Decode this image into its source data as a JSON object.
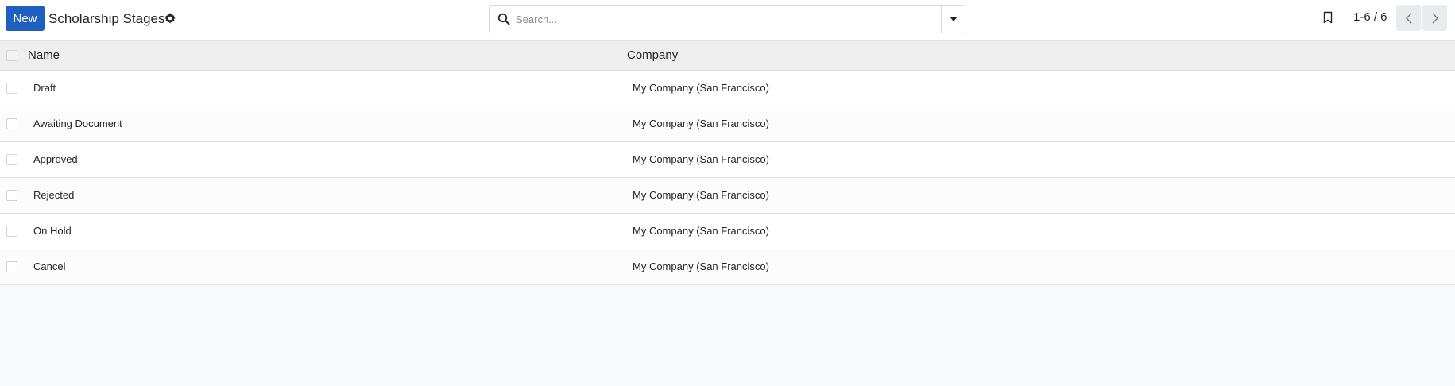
{
  "toolbar": {
    "new_label": "New",
    "title": "Scholarship Stages",
    "settings_icon": "gear-icon"
  },
  "search": {
    "placeholder": "Search...",
    "value": ""
  },
  "pager": {
    "value": "1-6 / 6"
  },
  "list": {
    "columns": [
      "Name",
      "Company"
    ],
    "rows": [
      {
        "name": "Draft",
        "company": "My Company (San Francisco)"
      },
      {
        "name": "Awaiting Document",
        "company": "My Company (San Francisco)"
      },
      {
        "name": "Approved",
        "company": "My Company (San Francisco)"
      },
      {
        "name": "Rejected",
        "company": "My Company (San Francisco)"
      },
      {
        "name": "On Hold",
        "company": "My Company (San Francisco)"
      },
      {
        "name": "Cancel",
        "company": "My Company (San Francisco)"
      }
    ]
  },
  "colors": {
    "primary": "#1f5fbf",
    "header_bg": "#eeeeee",
    "page_bg": "#f8f9fa"
  }
}
